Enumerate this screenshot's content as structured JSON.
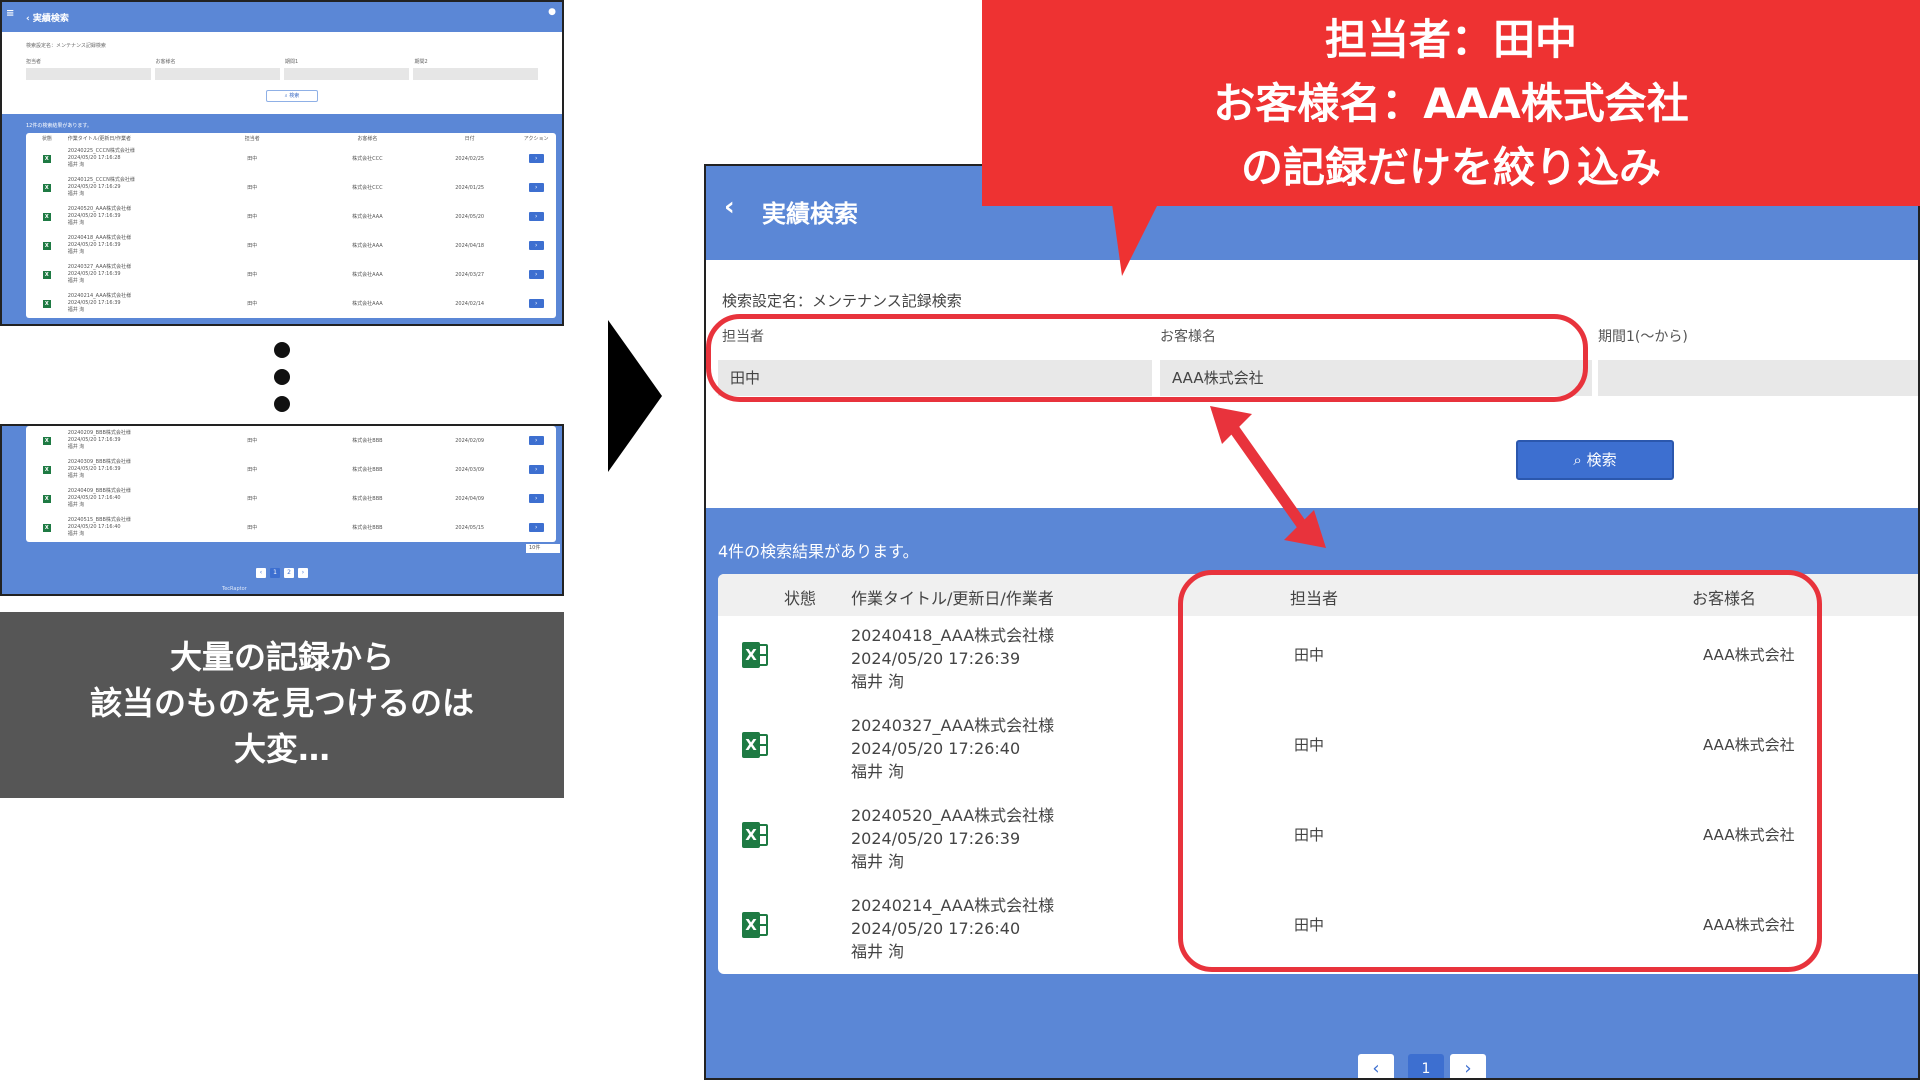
{
  "thumb": {
    "header_title": "実績検索",
    "menu_icon": "≡",
    "user_icon": "person",
    "setname": "検索設定名：メンテナンス記録検索",
    "labels": [
      "担当者",
      "お客様名",
      "期間1",
      "期間2"
    ],
    "search_label": "検索",
    "count": "12件の検索結果があります。",
    "columns": [
      "状態",
      "作業タイトル/更新日/作業者",
      "担当者",
      "お客様名",
      "日付",
      "アクション"
    ],
    "rows_top": [
      {
        "title": "20240225_CCCN株式会社様",
        "date": "2024/05/20 17:16:28",
        "worker": "福井 洵",
        "staff": "田中",
        "customer": "株式会社CCC",
        "day": "2024/02/25"
      },
      {
        "title": "20240125_CCCN株式会社様",
        "date": "2024/05/20 17:16:29",
        "worker": "福井 洵",
        "staff": "田中",
        "customer": "株式会社CCC",
        "day": "2024/01/25"
      },
      {
        "title": "20240520_AAA株式会社様",
        "date": "2024/05/20 17:16:39",
        "worker": "福井 洵",
        "staff": "田中",
        "customer": "株式会社AAA",
        "day": "2024/05/20"
      },
      {
        "title": "20240418_AAA株式会社様",
        "date": "2024/05/20 17:16:39",
        "worker": "福井 洵",
        "staff": "田中",
        "customer": "株式会社AAA",
        "day": "2024/04/18"
      },
      {
        "title": "20240327_AAA株式会社様",
        "date": "2024/05/20 17:16:39",
        "worker": "福井 洵",
        "staff": "田中",
        "customer": "株式会社AAA",
        "day": "2024/03/27"
      },
      {
        "title": "20240214_AAA株式会社様",
        "date": "2024/05/20 17:16:39",
        "worker": "福井 洵",
        "staff": "田中",
        "customer": "株式会社AAA",
        "day": "2024/02/14"
      }
    ],
    "rows_bottom": [
      {
        "title": "20240209_BBB株式会社様",
        "date": "2024/05/20 17:16:39",
        "worker": "福井 洵",
        "staff": "田中",
        "customer": "株式会社BBB",
        "day": "2024/02/09"
      },
      {
        "title": "20240309_BBB株式会社様",
        "date": "2024/05/20 17:16:39",
        "worker": "福井 洵",
        "staff": "田中",
        "customer": "株式会社BBB",
        "day": "2024/03/09"
      },
      {
        "title": "20240409_BBB株式会社様",
        "date": "2024/05/20 17:16:40",
        "worker": "福井 洵",
        "staff": "田中",
        "customer": "株式会社BBB",
        "day": "2024/04/09"
      },
      {
        "title": "20240515_BBB株式会社様",
        "date": "2024/05/20 17:16:40",
        "worker": "福井 洵",
        "staff": "田中",
        "customer": "株式会社BBB",
        "day": "2024/05/15"
      }
    ],
    "go_label": "›",
    "pager": [
      "‹",
      "1",
      "2",
      "›"
    ],
    "perpage": "10件",
    "footer": "TecRaptor"
  },
  "caption_left": [
    "大量の記録から",
    "該当のものを見つけるのは",
    "大変…"
  ],
  "callout": [
    "担当者：田中",
    "お客様名：AAA株式会社",
    "の記録だけを絞り込み"
  ],
  "main": {
    "back_icon": "‹",
    "title": "実績検索",
    "setname": "検索設定名：メンテナンス記録検索",
    "labels": {
      "staff": "担当者",
      "customer": "お客様名",
      "period1": "期間1(～から)"
    },
    "inputs": {
      "staff": "田中",
      "customer": "AAA株式会社",
      "period1": ""
    },
    "search_label": "検索",
    "count": "4件の検索結果があります。",
    "columns": {
      "status": "状態",
      "title": "作業タイトル/更新日/作業者",
      "staff": "担当者",
      "customer": "お客様名"
    },
    "rows": [
      {
        "title": "20240418_AAA株式会社様",
        "date": "2024/05/20 17:26:39",
        "worker": "福井 洵",
        "staff": "田中",
        "customer": "AAA株式会社"
      },
      {
        "title": "20240327_AAA株式会社様",
        "date": "2024/05/20 17:26:40",
        "worker": "福井 洵",
        "staff": "田中",
        "customer": "AAA株式会社"
      },
      {
        "title": "20240520_AAA株式会社様",
        "date": "2024/05/20 17:26:39",
        "worker": "福井 洵",
        "staff": "田中",
        "customer": "AAA株式会社"
      },
      {
        "title": "20240214_AAA株式会社様",
        "date": "2024/05/20 17:26:40",
        "worker": "福井 洵",
        "staff": "田中",
        "customer": "AAA株式会社"
      }
    ],
    "pager": {
      "prev": "‹",
      "page": "1",
      "next": "›"
    }
  },
  "colors": {
    "brand_blue": "#5b87d6",
    "button_blue": "#3d6fd0",
    "accent_red": "#ee3232",
    "excel_green": "#1e7a43",
    "caption_gray": "#565656"
  }
}
